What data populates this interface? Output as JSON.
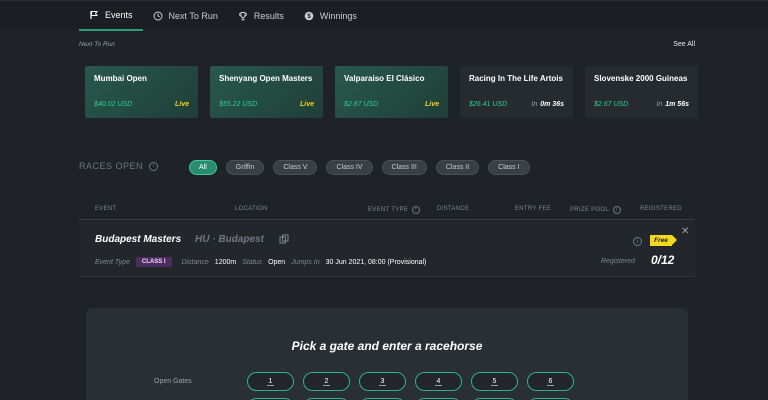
{
  "tabs": [
    {
      "label": "Events",
      "icon": "flag-icon",
      "active": true
    },
    {
      "label": "Next To Run",
      "icon": "clock-icon"
    },
    {
      "label": "Results",
      "icon": "trophy-icon"
    },
    {
      "label": "Winnings",
      "icon": "dollar-coin-icon"
    }
  ],
  "next_to_run": {
    "title": "Next To Run",
    "see_all": "See All",
    "cards": [
      {
        "name": "Mumbai Open",
        "prize": "$40.02 USD",
        "status": "Live"
      },
      {
        "name": "Shenyang Open Masters",
        "prize": "$55.22 USD",
        "status": "Live"
      },
      {
        "name": "Valparaiso El Clásico",
        "prize": "$2.67 USD",
        "status": "Live"
      },
      {
        "name": "Racing In The Life Artois",
        "prize": "$26.41 USD",
        "in_label": "In",
        "in_value": "0m 36s"
      },
      {
        "name": "Slovenske 2000 Guineas",
        "prize": "$2.67 USD",
        "in_label": "In",
        "in_value": "1m 56s"
      }
    ]
  },
  "races_open": {
    "title": "RACES OPEN",
    "filters": [
      "All",
      "Griffin",
      "Class V",
      "Class IV",
      "Class III",
      "Class II",
      "Class I"
    ],
    "active_filter": "All"
  },
  "table": {
    "headers": {
      "event": "EVENT",
      "location": "LOCATION",
      "event_type": "EVENT TYPE",
      "distance": "DISTANCE",
      "entry_fee": "ENTRY FEE",
      "prize_pool": "PRIZE POOL",
      "registered": "REGISTERED"
    }
  },
  "race": {
    "name": "Budapest Masters",
    "location": "HU · Budapest",
    "event_type_label": "Event Type",
    "class": "CLASS I",
    "distance_label": "Distance",
    "distance": "1200m",
    "status_label": "Status",
    "status": "Open",
    "jumps_label": "Jumps In",
    "jumps": "30 Jun 2021, 08:00 (Provisional)",
    "fee_badge": "Free",
    "registered_label": "Registered",
    "registered": "0/12"
  },
  "gate_panel": {
    "title": "Pick a gate and enter a racehorse",
    "open_gates_label": "Open Gates",
    "gates": [
      "1",
      "2",
      "3",
      "4",
      "5",
      "6"
    ]
  },
  "colors": {
    "background": "#1f2327",
    "accent": "#2a9d78",
    "prize": "#2bd38e",
    "live": "#f2d21b",
    "class_badge": "#4a2e5e"
  }
}
